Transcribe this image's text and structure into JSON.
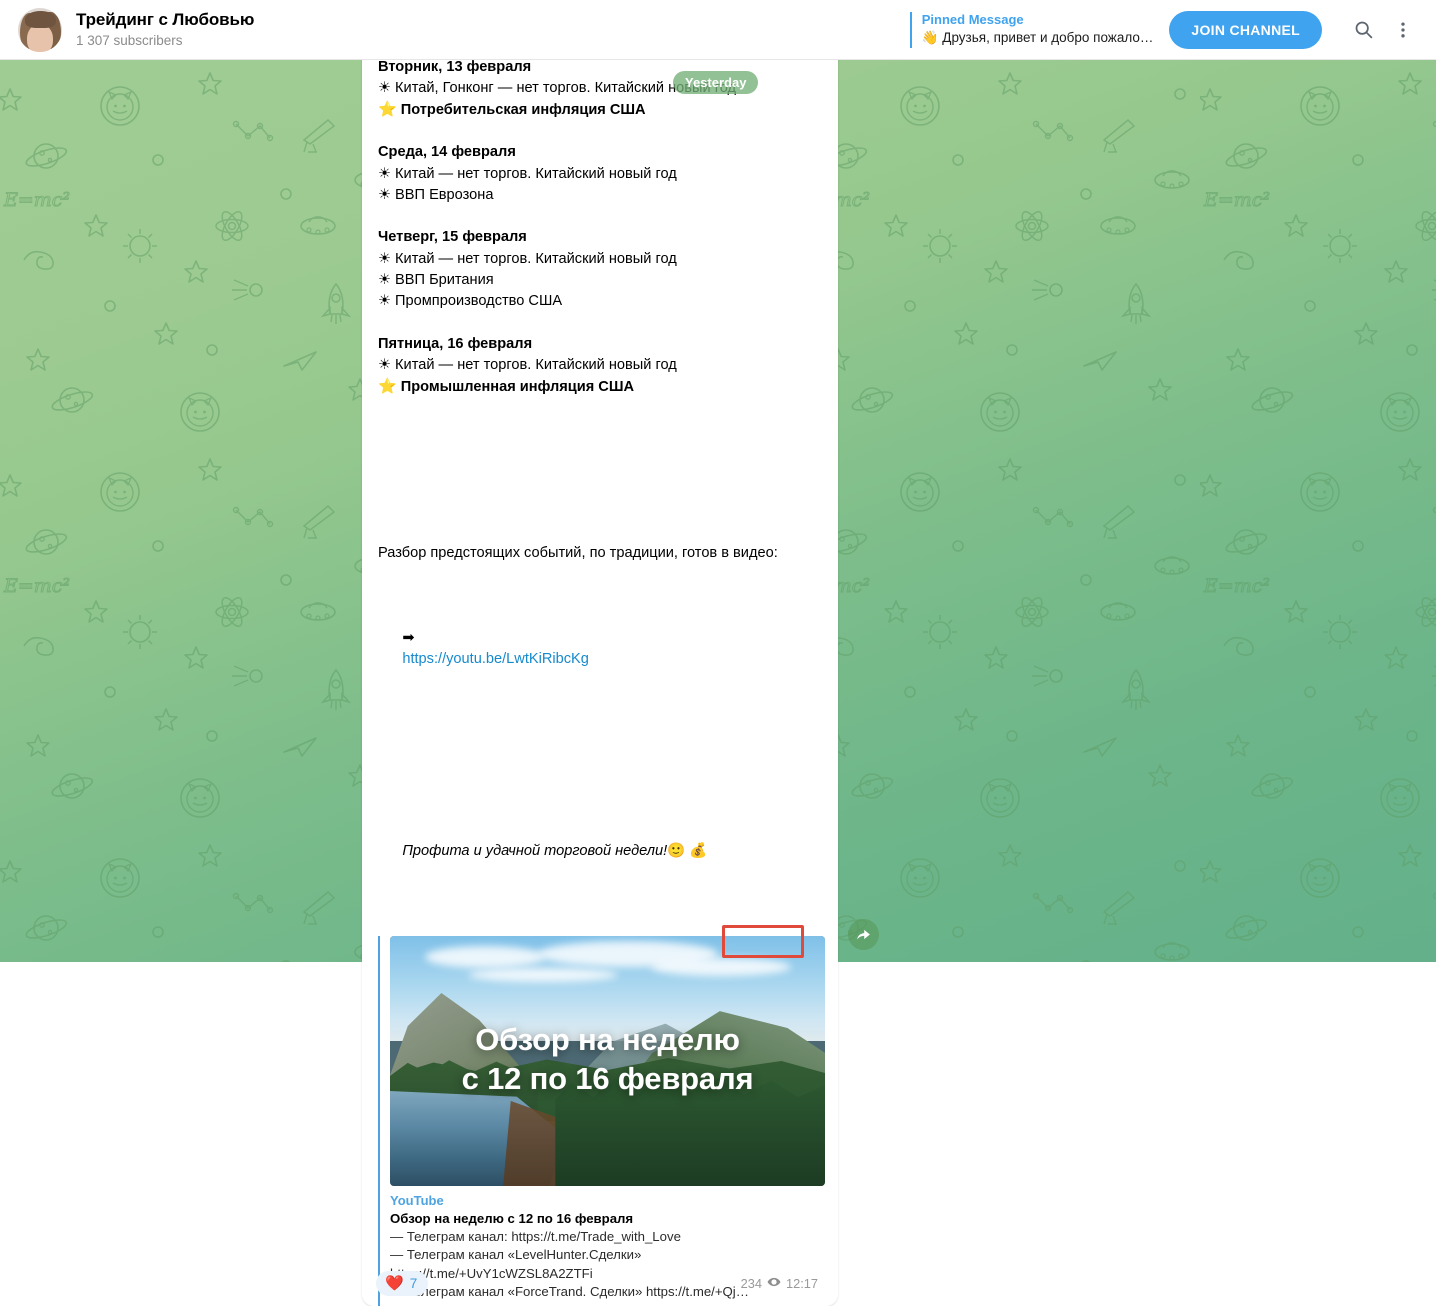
{
  "header": {
    "avatar_name": "channel-avatar",
    "title": "Трейдинг с Любовью",
    "subscribers": "1 307 subscribers",
    "pinned_label": "Pinned Message",
    "pinned_text": "👋 Друзья, привет и добро пожало…",
    "join_label": "JOIN CHANNEL",
    "search_icon": "search-icon",
    "menu_icon": "more-vertical-icon"
  },
  "date_badge": "Yesterday",
  "message": {
    "blocks": [
      {
        "day": "Вторник, 13 февраля",
        "lines": [
          {
            "emoji": "☀",
            "text": "Китай, Гонконг — нет торгов. Китайский новый год",
            "bold": false
          },
          {
            "emoji": "⭐",
            "text": "Потребительская инфляция США",
            "bold": true
          }
        ]
      },
      {
        "day": "Среда, 14 февраля",
        "lines": [
          {
            "emoji": "☀",
            "text": "Китай — нет торгов. Китайский новый год",
            "bold": false
          },
          {
            "emoji": "☀",
            "text": "ВВП Еврозона",
            "bold": false
          }
        ]
      },
      {
        "day": "Четверг, 15 февраля",
        "lines": [
          {
            "emoji": "☀",
            "text": "Китай — нет торгов. Китайский новый год",
            "bold": false
          },
          {
            "emoji": "☀",
            "text": "ВВП Британия",
            "bold": false
          },
          {
            "emoji": "☀",
            "text": "Промпроизводство США",
            "bold": false
          }
        ]
      },
      {
        "day": "Пятница, 16 февраля",
        "lines": [
          {
            "emoji": "☀",
            "text": "Китай — нет торгов. Китайский новый год",
            "bold": false
          },
          {
            "emoji": "⭐",
            "text": "Промышленная инфляция США",
            "bold": true
          }
        ]
      }
    ],
    "outro_line": "Разбор предстоящих событий, по традиции, готов в видео:",
    "link_emoji": "➡",
    "link_url": "https://youtu.be/LwtKiRibcKg",
    "closing": "Профита и удачной торговой недели!",
    "closing_emoji": "🙂 💰"
  },
  "preview": {
    "site": "YouTube",
    "title": "Обзор на неделю с 12 по 16 февраля",
    "description": "— Телеграм канал: https://t.me/Trade_with_Love\n— Телеграм канал «LevelHunter.Сделки»\nhttps://t.me/+UvY1cWZSL8A2ZTFi\n— Телеграм канал «ForceTrand. Сделки» https://t.me/+Qj…",
    "thumb_title_line1": "Обзор на неделю",
    "thumb_title_line2": "с 12 по 16 февраля"
  },
  "footer": {
    "reaction_emoji": "❤️",
    "reaction_count": "7",
    "views": "234",
    "eye_icon": "eye-icon",
    "time": "12:17"
  },
  "share_icon": "share-arrow-icon",
  "colors": {
    "accent_blue": "#3fa3ef",
    "link_blue": "#168acd",
    "highlight_red": "#e04a3a",
    "bg_green_top": "#9fcc92",
    "bg_green_bottom": "#63b08a"
  }
}
